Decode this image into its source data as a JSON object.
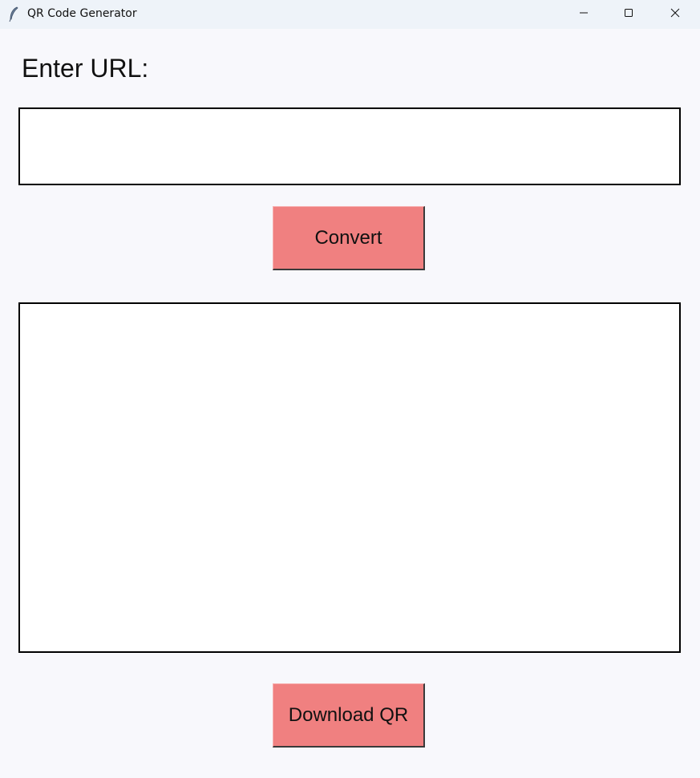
{
  "window": {
    "title": "QR Code Generator",
    "app_icon": "feather-icon",
    "controls": {
      "minimize_icon": "minimize-icon",
      "maximize_icon": "maximize-icon",
      "close_icon": "close-icon"
    }
  },
  "form": {
    "url_label": "Enter URL:",
    "url_value": "",
    "convert_label": "Convert",
    "download_label": "Download QR"
  },
  "colors": {
    "button_bg": "#f08080",
    "window_bg": "#f8f8fc",
    "titlebar_bg": "#eef3f9"
  }
}
